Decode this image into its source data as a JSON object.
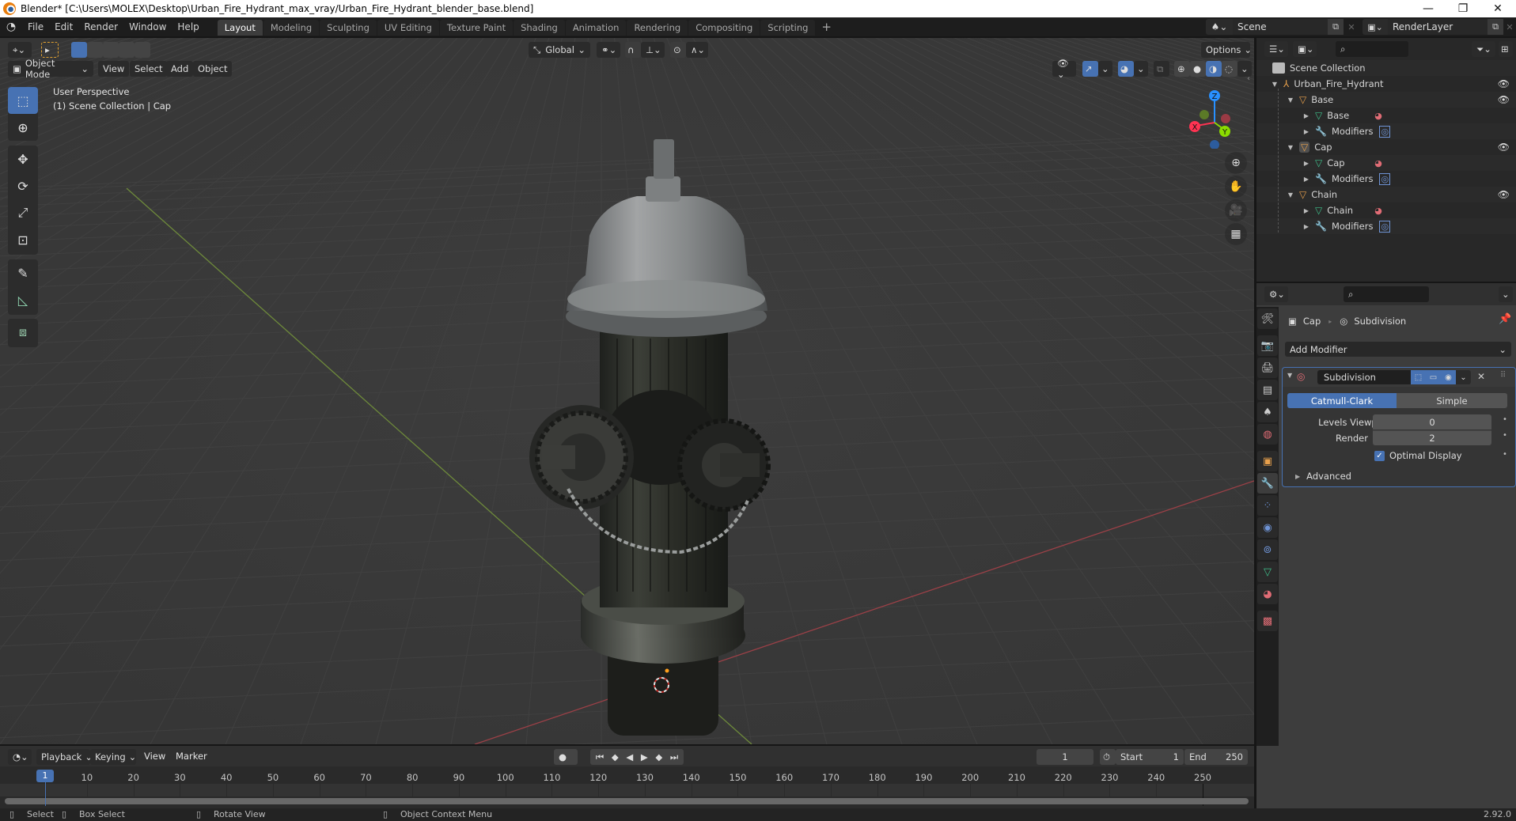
{
  "window": {
    "title": "Blender* [C:\\Users\\MOLEX\\Desktop\\Urban_Fire_Hydrant_max_vray/Urban_Fire_Hydrant_blender_base.blend]",
    "controls": {
      "minimize": "—",
      "maximize": "❐",
      "close": "✕"
    }
  },
  "menubar": {
    "items": [
      "File",
      "Edit",
      "Render",
      "Window",
      "Help"
    ],
    "workspaces": [
      "Layout",
      "Modeling",
      "Sculpting",
      "UV Editing",
      "Texture Paint",
      "Shading",
      "Animation",
      "Rendering",
      "Compositing",
      "Scripting"
    ],
    "active_workspace": "Layout",
    "add_workspace": "+",
    "scene": "Scene",
    "view_layer": "RenderLayer"
  },
  "viewport": {
    "header": {
      "transform_orientation": "Global",
      "options_label": "Options",
      "mode": "Object Mode",
      "menus": [
        "View",
        "Select",
        "Add",
        "Object"
      ]
    },
    "overlay_text": {
      "perspective": "User Perspective",
      "collection": "(1) Scene Collection | Cap"
    },
    "gizmo": {
      "x": "X",
      "y": "Y",
      "z": "Z"
    },
    "tools": [
      "select-box",
      "cursor",
      "move",
      "rotate",
      "scale",
      "transform",
      "annotate",
      "measure",
      "add-cube"
    ],
    "colors": {
      "accent": "#4772b3",
      "x_axis": "#ff3352",
      "y_axis": "#8bdc00",
      "z_axis": "#2890ff"
    }
  },
  "outliner": {
    "root": "Scene Collection",
    "rows": [
      {
        "label": "Urban_Fire_Hydrant",
        "depth": 0,
        "icon": "empty-icon",
        "expanded": true,
        "eye": true
      },
      {
        "label": "Base",
        "depth": 1,
        "icon": "mesh-object-icon",
        "expanded": true,
        "eye": true
      },
      {
        "label": "Base",
        "depth": 2,
        "icon": "mesh-data-icon",
        "extra": "material-icon"
      },
      {
        "label": "Modifiers",
        "depth": 2,
        "icon": "wrench-icon",
        "extra": "subdivision-icon"
      },
      {
        "label": "Cap",
        "depth": 1,
        "icon": "mesh-object-icon",
        "expanded": true,
        "eye": true,
        "active": true
      },
      {
        "label": "Cap",
        "depth": 2,
        "icon": "mesh-data-icon",
        "extra": "material-icon"
      },
      {
        "label": "Modifiers",
        "depth": 2,
        "icon": "wrench-icon",
        "extra": "subdivision-icon"
      },
      {
        "label": "Chain",
        "depth": 1,
        "icon": "mesh-object-icon",
        "expanded": true,
        "eye": true
      },
      {
        "label": "Chain",
        "depth": 2,
        "icon": "mesh-data-icon",
        "extra": "material-icon"
      },
      {
        "label": "Modifiers",
        "depth": 2,
        "icon": "wrench-icon",
        "extra": "subdivision-icon"
      }
    ]
  },
  "properties": {
    "breadcrumb": {
      "object": "Cap",
      "modifier": "Subdivision"
    },
    "add_modifier": "Add Modifier",
    "modifier": {
      "name": "Subdivision",
      "type_options": [
        "Catmull-Clark",
        "Simple"
      ],
      "active_type": "Catmull-Clark",
      "levels_viewport_label": "Levels Viewport",
      "levels_viewport": "0",
      "render_label": "Render",
      "render": "2",
      "optimal_display_label": "Optimal Display",
      "optimal_display": true,
      "advanced_label": "Advanced"
    },
    "tabs": [
      "tool",
      "render",
      "output",
      "view-layer",
      "scene",
      "world",
      "object",
      "modifiers",
      "particles",
      "physics",
      "constraints",
      "data",
      "material",
      "texture"
    ],
    "active_tab": "modifiers"
  },
  "timeline": {
    "menus": [
      "Playback",
      "Keying",
      "View",
      "Marker"
    ],
    "current_frame": "1",
    "start_label": "Start",
    "start": "1",
    "end_label": "End",
    "end": "250",
    "ticks": [
      "10",
      "20",
      "30",
      "40",
      "50",
      "60",
      "70",
      "80",
      "90",
      "100",
      "110",
      "120",
      "130",
      "140",
      "150",
      "160",
      "170",
      "180",
      "190",
      "200",
      "210",
      "220",
      "230",
      "240",
      "250"
    ],
    "playhead": "1"
  },
  "statusbar": {
    "hints": [
      "Select",
      "Box Select",
      "Rotate View",
      "Object Context Menu"
    ],
    "version": "2.92.0"
  }
}
